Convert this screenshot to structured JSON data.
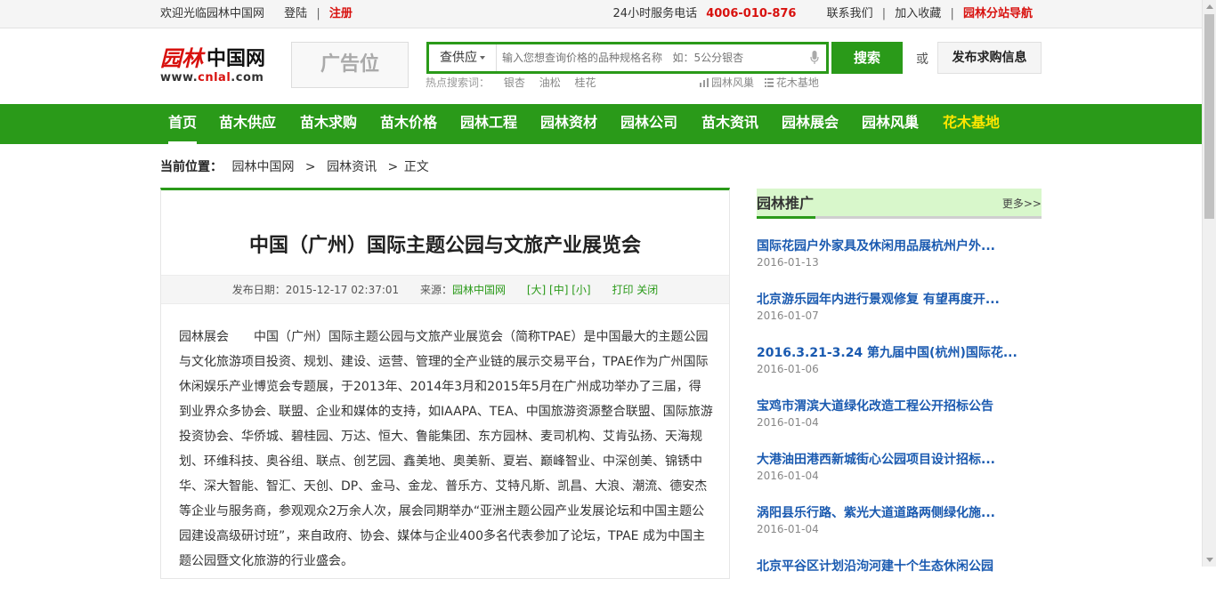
{
  "topbar": {
    "welcome": "欢迎光临园林中国网",
    "login": "登陆",
    "sep": "|",
    "register": "注册",
    "hotline_label": "24小时服务电话",
    "hotline_number": "4006-010-876",
    "contact": "联系我们",
    "bookmark": "加入收藏",
    "substations": "园林分站导航"
  },
  "logo": {
    "mark": "园林",
    "cn": "中国网",
    "url_prefix": "www.",
    "url_brand": "cnlal",
    "url_suffix": ".com"
  },
  "ad": {
    "label": "广告位"
  },
  "search": {
    "type_selected": "查供应",
    "placeholder": "输入您想查询价格的品种规格名称   如：5公分银杏",
    "button": "搜索",
    "or": "或",
    "publish": "发布求购信息",
    "hot_label": "热点搜索词：",
    "hot_words": [
      "银杏",
      "油松",
      "桂花"
    ],
    "quick_links": [
      "园林风巢",
      "花木基地"
    ]
  },
  "nav": {
    "items": [
      "首页",
      "苗木供应",
      "苗木求购",
      "苗木价格",
      "园林工程",
      "园林资材",
      "园林公司",
      "苗木资讯",
      "园林展会",
      "园林风巢",
      "花木基地"
    ],
    "active": "首页",
    "highlight": "花木基地"
  },
  "breadcrumb": {
    "label": "当前位置：",
    "items": [
      "园林中国网",
      "园林资讯",
      "正文"
    ],
    "sep": ">"
  },
  "article": {
    "title": "中国（广州）国际主题公园与文旅产业展览会",
    "date_label": "发布日期：",
    "date": "2015-12-17 02:37:01",
    "source_label": "来源：",
    "source": "园林中国网",
    "size_large": "[大]",
    "size_medium": "[中]",
    "size_small": "[小]",
    "print": "打印",
    "close": "关闭",
    "body": "园林展会　　中国（广州）国际主题公园与文旅产业展览会（简称TPAE）是中国最大的主题公园与文化旅游项目投资、规划、建设、运营、管理的全产业链的展示交易平台，TPAE作为广州国际休闲娱乐产业博览会专题展，于2013年、2014年3月和2015年5月在广州成功举办了三届，得到业界众多协会、联盟、企业和媒体的支持，如IAAPA、TEA、中国旅游资源整合联盟、国际旅游投资协会、华侨城、碧桂园、万达、恒大、鲁能集团、东方园林、麦司机构、艾肯弘扬、天海规划、环维科技、奥谷组、联点、创艺园、鑫美地、奥美新、夏岩、巅峰智业、中深创美、锦锈中华、深大智能、智汇、天创、DP、金马、金龙、普乐方、艾特凡斯、凯昌、大浪、潮流、德安杰等企业与服务商，参观观众2万余人次，展会同期举办“亚洲主题公园产业发展论坛和中国主题公园建设高级研讨班”，来自政府、协会、媒体与企业400多名代表参加了论坛，TPAE 成为中国主题公园暨文化旅游的行业盛会。"
  },
  "sidebar": {
    "title": "园林推广",
    "more": "更多>>",
    "items": [
      {
        "title": "国际花园户外家具及休闲用品展杭州户外...",
        "date": "2016-01-13"
      },
      {
        "title": "北京游乐园年内进行景观修复 有望再度开...",
        "date": "2016-01-07"
      },
      {
        "title": "2016.3.21-3.24 第九届中国(杭州)国际花...",
        "date": "2016-01-06"
      },
      {
        "title": "宝鸡市渭滨大道绿化改造工程公开招标公告",
        "date": "2016-01-04"
      },
      {
        "title": "大港油田港西新城街心公园项目设计招标...",
        "date": "2016-01-04"
      },
      {
        "title": "涡阳县乐行路、紫光大道道路两侧绿化施...",
        "date": "2016-01-04"
      },
      {
        "title": "北京平谷区计划沿泃河建十个生态休闲公园",
        "date": ""
      }
    ]
  },
  "colors": {
    "brand_green": "#2a9a19",
    "brand_red": "#d8110e",
    "link_blue": "#1a5ab0",
    "nav_highlight": "#ffe600"
  }
}
